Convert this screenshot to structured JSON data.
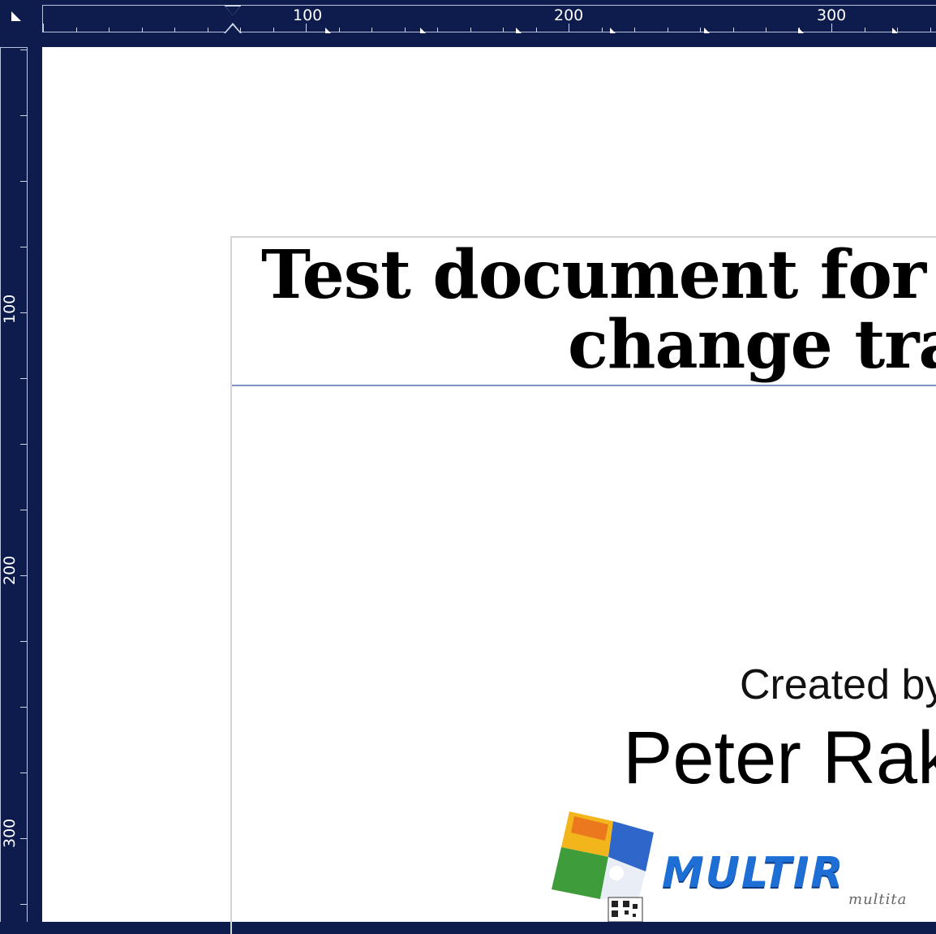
{
  "ruler": {
    "horizontal_labels": [
      "100",
      "200",
      "300"
    ],
    "vertical_labels": [
      "100",
      "200",
      "300"
    ]
  },
  "document": {
    "title_line1": "Test document for r",
    "title_line2": "change tra",
    "created_by": "Created by",
    "author": "Peter Rak"
  },
  "logo": {
    "brand_text": "MULTIR",
    "tagline": "multita"
  },
  "colors": {
    "ruler_background": "#0e1b4d",
    "page": "#ffffff",
    "title_rule": "#7b94c3",
    "brand_blue": "#1d6fd6"
  }
}
